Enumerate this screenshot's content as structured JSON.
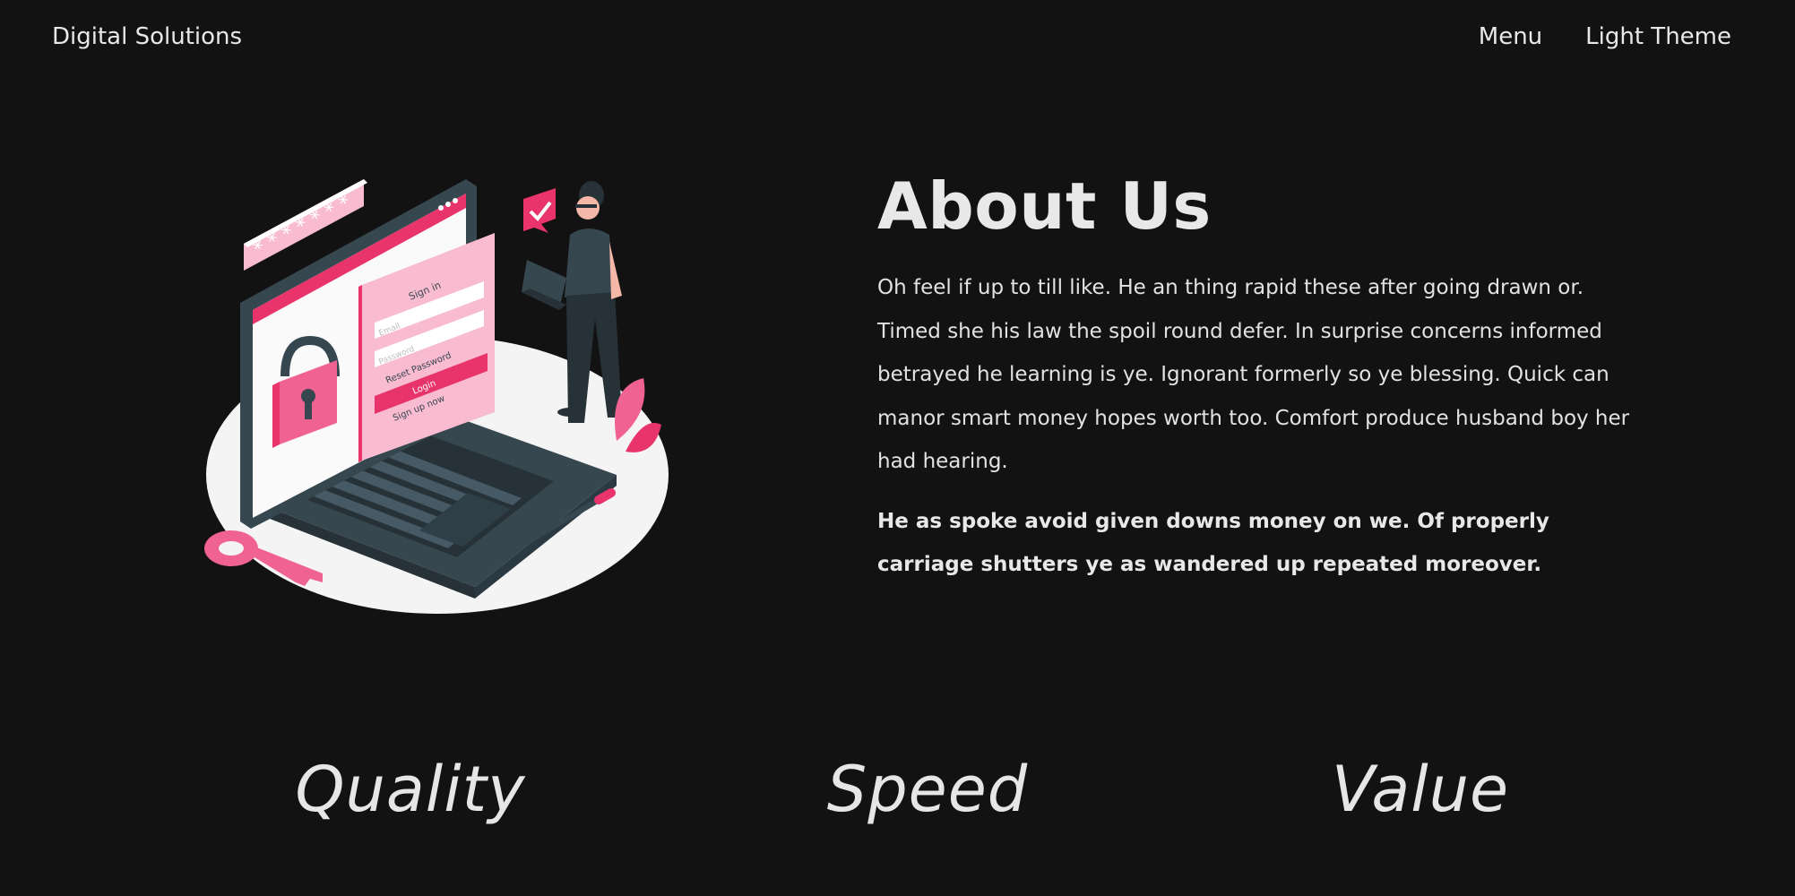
{
  "nav": {
    "brand": "Digital Solutions",
    "links": [
      "Menu",
      "Light Theme"
    ]
  },
  "illustration": {
    "signin_title": "Sign in",
    "email_placeholder": "Email",
    "password_placeholder": "Password",
    "reset_label": "Reset Password",
    "login_label": "Login",
    "signup_label": "Sign up now",
    "password_mask": "* * * * * * *"
  },
  "about": {
    "title": "About Us",
    "paragraph": "Oh feel if up to till like. He an thing rapid these after going drawn or. Timed she his law the spoil round defer. In surprise concerns informed betrayed he learning is ye. Ignorant formerly so ye blessing. Quick can manor smart money hopes worth too. Comfort produce husband boy her had hearing.",
    "bold_paragraph": "He as spoke avoid given downs money on we. Of properly carriage shutters ye as wandered up repeated moreover."
  },
  "values": [
    "Quality",
    "Speed",
    "Value"
  ],
  "colors": {
    "background": "#121212",
    "accent": "#e8336b",
    "text": "#e4e4e4"
  }
}
